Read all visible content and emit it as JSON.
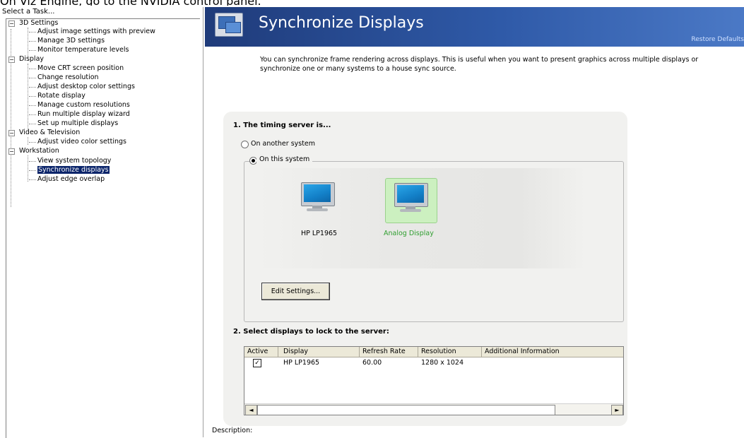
{
  "caption": "On Viz Engine, go to the NVIDIA control panel.",
  "task_panel": {
    "title": "Select a Task...",
    "categories": [
      {
        "label": "3D Settings",
        "items": [
          "Adjust image settings with preview",
          "Manage 3D settings",
          "Monitor temperature levels"
        ]
      },
      {
        "label": "Display",
        "items": [
          "Move CRT screen position",
          "Change resolution",
          "Adjust desktop color settings",
          "Rotate display",
          "Manage custom resolutions",
          "Run multiple display wizard",
          "Set up multiple displays"
        ]
      },
      {
        "label": "Video & Television",
        "items": [
          "Adjust video color settings"
        ]
      },
      {
        "label": "Workstation",
        "items": [
          "View system topology",
          "Synchronize displays",
          "Adjust edge overlap"
        ]
      }
    ],
    "selected": "Synchronize displays"
  },
  "page": {
    "title": "Synchronize Displays",
    "restore_defaults": "Restore Defaults",
    "intro": "You can synchronize frame rendering across displays. This is useful when you want to present graphics across multiple displays or synchronize one or many systems to a house sync source."
  },
  "timing": {
    "heading": "1. The timing server is...",
    "option_other": "On another system",
    "option_this": "On this system",
    "selected_option": "On this system",
    "displays": [
      {
        "label": "HP LP1965",
        "selected": false
      },
      {
        "label": "Analog Display",
        "selected": true
      }
    ],
    "edit_settings": "Edit Settings..."
  },
  "lock": {
    "heading": "2. Select displays to lock to the server:",
    "columns": [
      "Active",
      "Display",
      "Refresh Rate",
      "Resolution",
      "Additional Information"
    ],
    "rows": [
      {
        "active": true,
        "display": "HP LP1965",
        "refresh_rate": "60.00",
        "resolution": "1280 x 1024",
        "info": ""
      }
    ]
  },
  "description_label": "Description:",
  "colors": {
    "header": "#2f5aa8",
    "selection": "#0a246a",
    "highlight": "#ccf0c0"
  }
}
